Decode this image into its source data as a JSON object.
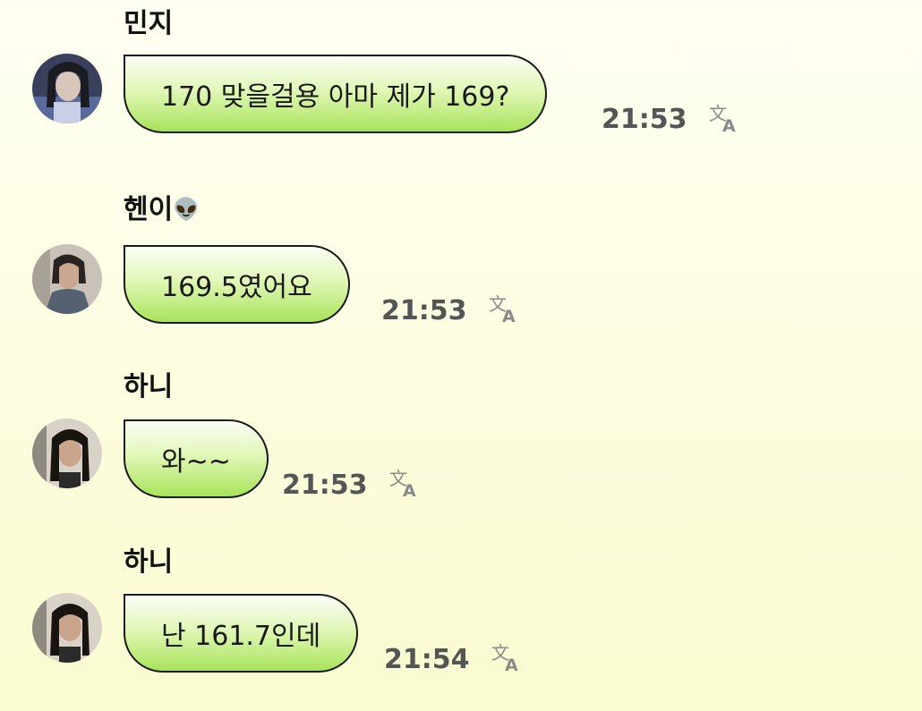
{
  "messages": [
    {
      "sender": "민지",
      "text": "170 맞을걸용 아마 제가 169?",
      "time": "21:53",
      "translate_icon": "translate-icon"
    },
    {
      "sender": "헨이",
      "sender_emoji": "👽",
      "text": "169.5였어요",
      "time": "21:53",
      "translate_icon": "translate-icon"
    },
    {
      "sender": "하니",
      "text": "와~~",
      "time": "21:53",
      "translate_icon": "translate-icon"
    },
    {
      "sender": "하니",
      "text": "난 161.7인데",
      "time": "21:54",
      "translate_icon": "translate-icon"
    }
  ],
  "colors": {
    "bubble_top": "#fbfdf5",
    "bubble_bottom": "#a8e35a",
    "bubble_border": "#1a1a1a",
    "time": "#555555",
    "translate_icon": "#8a8a8a"
  }
}
